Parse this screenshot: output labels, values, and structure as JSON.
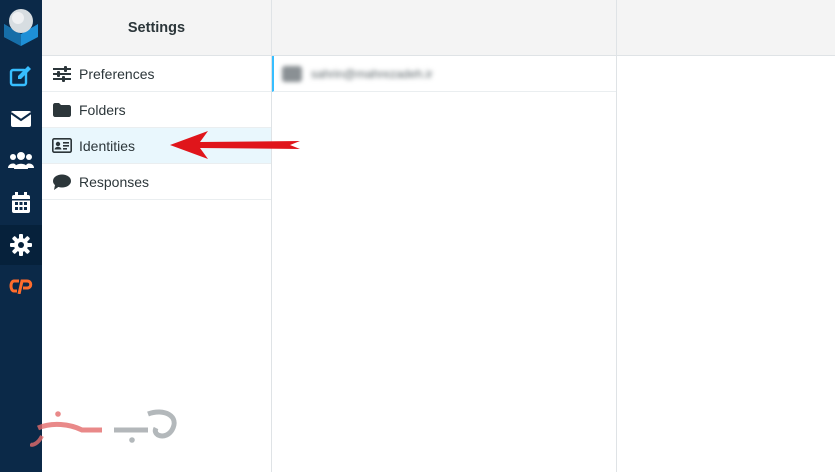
{
  "rail": {
    "items": [
      {
        "name": "compose-icon"
      },
      {
        "name": "mail-icon"
      },
      {
        "name": "contacts-icon"
      },
      {
        "name": "calendar-icon"
      },
      {
        "name": "settings-icon",
        "selected": true
      },
      {
        "name": "cpanel-icon"
      }
    ],
    "colors": {
      "background": "#0b2948",
      "icon": "#37beff",
      "cpanel": "#ff6c2c"
    }
  },
  "settings": {
    "title": "Settings",
    "items": [
      {
        "label": "Preferences",
        "icon": "sliders-icon"
      },
      {
        "label": "Folders",
        "icon": "folder-icon"
      },
      {
        "label": "Identities",
        "icon": "id-card-icon",
        "selected": true
      },
      {
        "label": "Responses",
        "icon": "speech-bubble-icon"
      }
    ]
  },
  "identities": {
    "rows": [
      {
        "email": "sahrin@mahrezadeh.ir"
      }
    ]
  },
  "annotation": {
    "color": "#e0151b"
  },
  "watermark": {
    "text": "وب رمز",
    "colors": [
      "#9aa0a4",
      "#e46b6b"
    ]
  }
}
